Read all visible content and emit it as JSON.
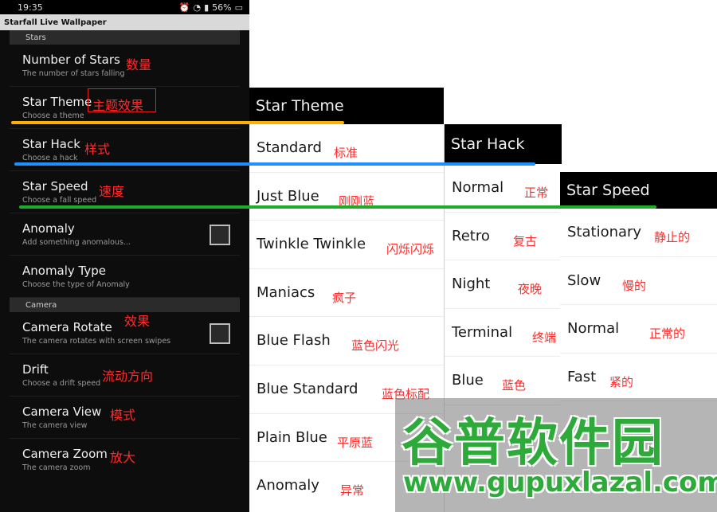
{
  "phone": {
    "time": "19:35",
    "battery": "56%",
    "app_title": "Starfall Live Wallpaper",
    "sections": [
      {
        "label": "Stars",
        "items": [
          {
            "title": "Number of Stars",
            "subtitle": "The number of stars falling",
            "cn": "数量"
          },
          {
            "title": "Star Theme",
            "subtitle": "Choose a theme",
            "cn": "主题效果"
          },
          {
            "title": "Star Hack",
            "subtitle": "Choose a hack",
            "cn": "样式"
          },
          {
            "title": "Star Speed",
            "subtitle": "Choose a fall speed",
            "cn": "速度"
          },
          {
            "title": "Anomaly",
            "subtitle": "Add something anomalous...",
            "cn": ""
          },
          {
            "title": "Anomaly Type",
            "subtitle": "Choose the type of Anomaly",
            "cn": ""
          }
        ]
      },
      {
        "label": "Camera",
        "items": [
          {
            "title": "Camera Rotate",
            "subtitle": "The camera rotates with screen swipes",
            "cn": "效果"
          },
          {
            "title": "Drift",
            "subtitle": "Choose a drift speed",
            "cn": "流动方向"
          },
          {
            "title": "Camera View",
            "subtitle": "The camera view",
            "cn": "模式"
          },
          {
            "title": "Camera Zoom",
            "subtitle": "The camera zoom",
            "cn": "放大"
          }
        ]
      }
    ]
  },
  "theme_panel": {
    "title": "Star Theme",
    "options": [
      {
        "label": "Standard",
        "cn": "标准"
      },
      {
        "label": "Just Blue",
        "cn": "刚刚蓝"
      },
      {
        "label": "Twinkle Twinkle",
        "cn": "闪烁闪烁"
      },
      {
        "label": "Maniacs",
        "cn": "疯子"
      },
      {
        "label": "Blue Flash",
        "cn": "蓝色闪光"
      },
      {
        "label": "Blue Standard",
        "cn": "蓝色标配"
      },
      {
        "label": "Plain Blue",
        "cn": "平原蓝"
      },
      {
        "label": "Anomaly",
        "cn": "异常"
      }
    ]
  },
  "hack_panel": {
    "title": "Star Hack",
    "options": [
      {
        "label": "Normal",
        "cn": "正常"
      },
      {
        "label": "Retro",
        "cn": "复古"
      },
      {
        "label": "Night",
        "cn": "夜晚"
      },
      {
        "label": "Terminal",
        "cn": "终端"
      },
      {
        "label": "Blue",
        "cn": "蓝色"
      }
    ]
  },
  "speed_panel": {
    "title": "Star Speed",
    "options": [
      {
        "label": "Stationary",
        "cn": "静止的"
      },
      {
        "label": "Slow",
        "cn": "慢的"
      },
      {
        "label": "Normal",
        "cn": "正常的"
      },
      {
        "label": "Fast",
        "cn": "紧的"
      }
    ]
  },
  "watermark": {
    "logo": "谷普软件园",
    "url": "www.gupuxlazal.com"
  },
  "colors": {
    "theme_line": "#ffb000",
    "hack_line": "#1e90ff",
    "speed_line": "#1faa2a",
    "annotation_red": "#ff2a2a"
  }
}
